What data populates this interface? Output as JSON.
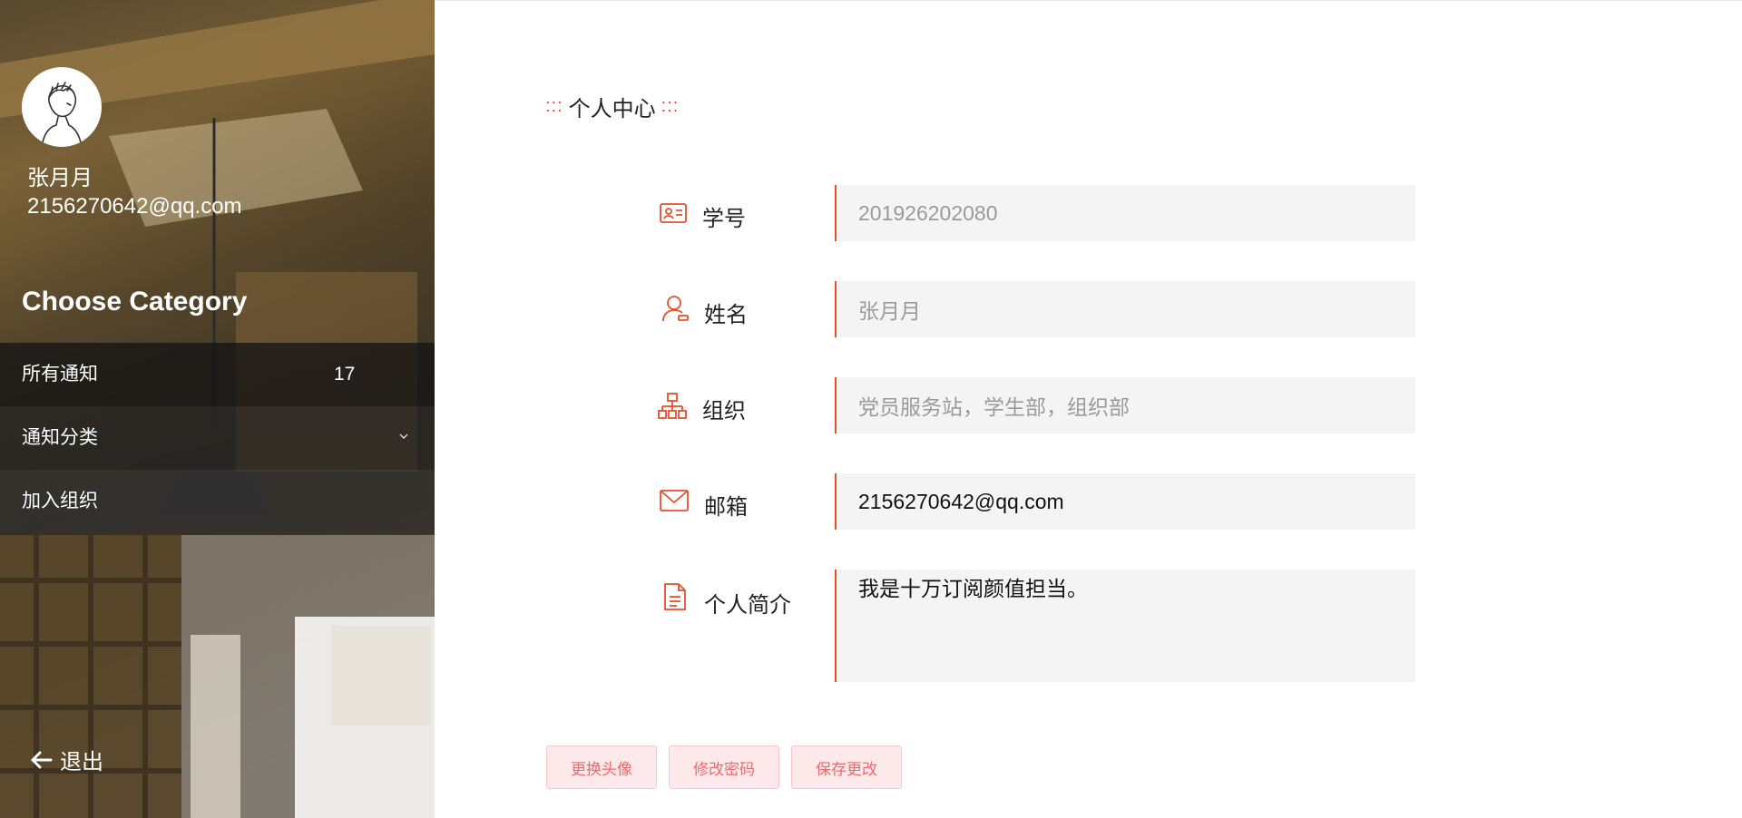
{
  "sidebar": {
    "user": {
      "name": "张月月",
      "email": "2156270642@qq.com"
    },
    "category_title": "Choose Category",
    "menu": [
      {
        "label": "所有通知",
        "count": "17"
      },
      {
        "label": "通知分类",
        "icon": "chevron-down-icon"
      },
      {
        "label": "加入组织"
      }
    ],
    "logout_label": "退出"
  },
  "main": {
    "title": "个人中心",
    "title_decoration": ":::",
    "fields": {
      "student_id": {
        "label": "学号",
        "value": "201926202080",
        "icon": "id-card-icon"
      },
      "name": {
        "label": "姓名",
        "value": "张月月",
        "icon": "user-icon"
      },
      "organization": {
        "label": "组织",
        "value": "党员服务站，学生部，组织部",
        "icon": "org-chart-icon"
      },
      "email": {
        "label": "邮箱",
        "value": "2156270642@qq.com",
        "icon": "mail-icon"
      },
      "bio": {
        "label": "个人简介",
        "value": "我是十万订阅颜值担当。",
        "icon": "document-icon"
      }
    },
    "buttons": {
      "change_avatar": "更换头像",
      "change_password": "修改密码",
      "save": "保存更改"
    }
  },
  "colors": {
    "accent": "#e4502e",
    "button_bg": "#fde9ea",
    "button_text": "#ef6a6f",
    "field_bg": "#f4f4f4"
  }
}
